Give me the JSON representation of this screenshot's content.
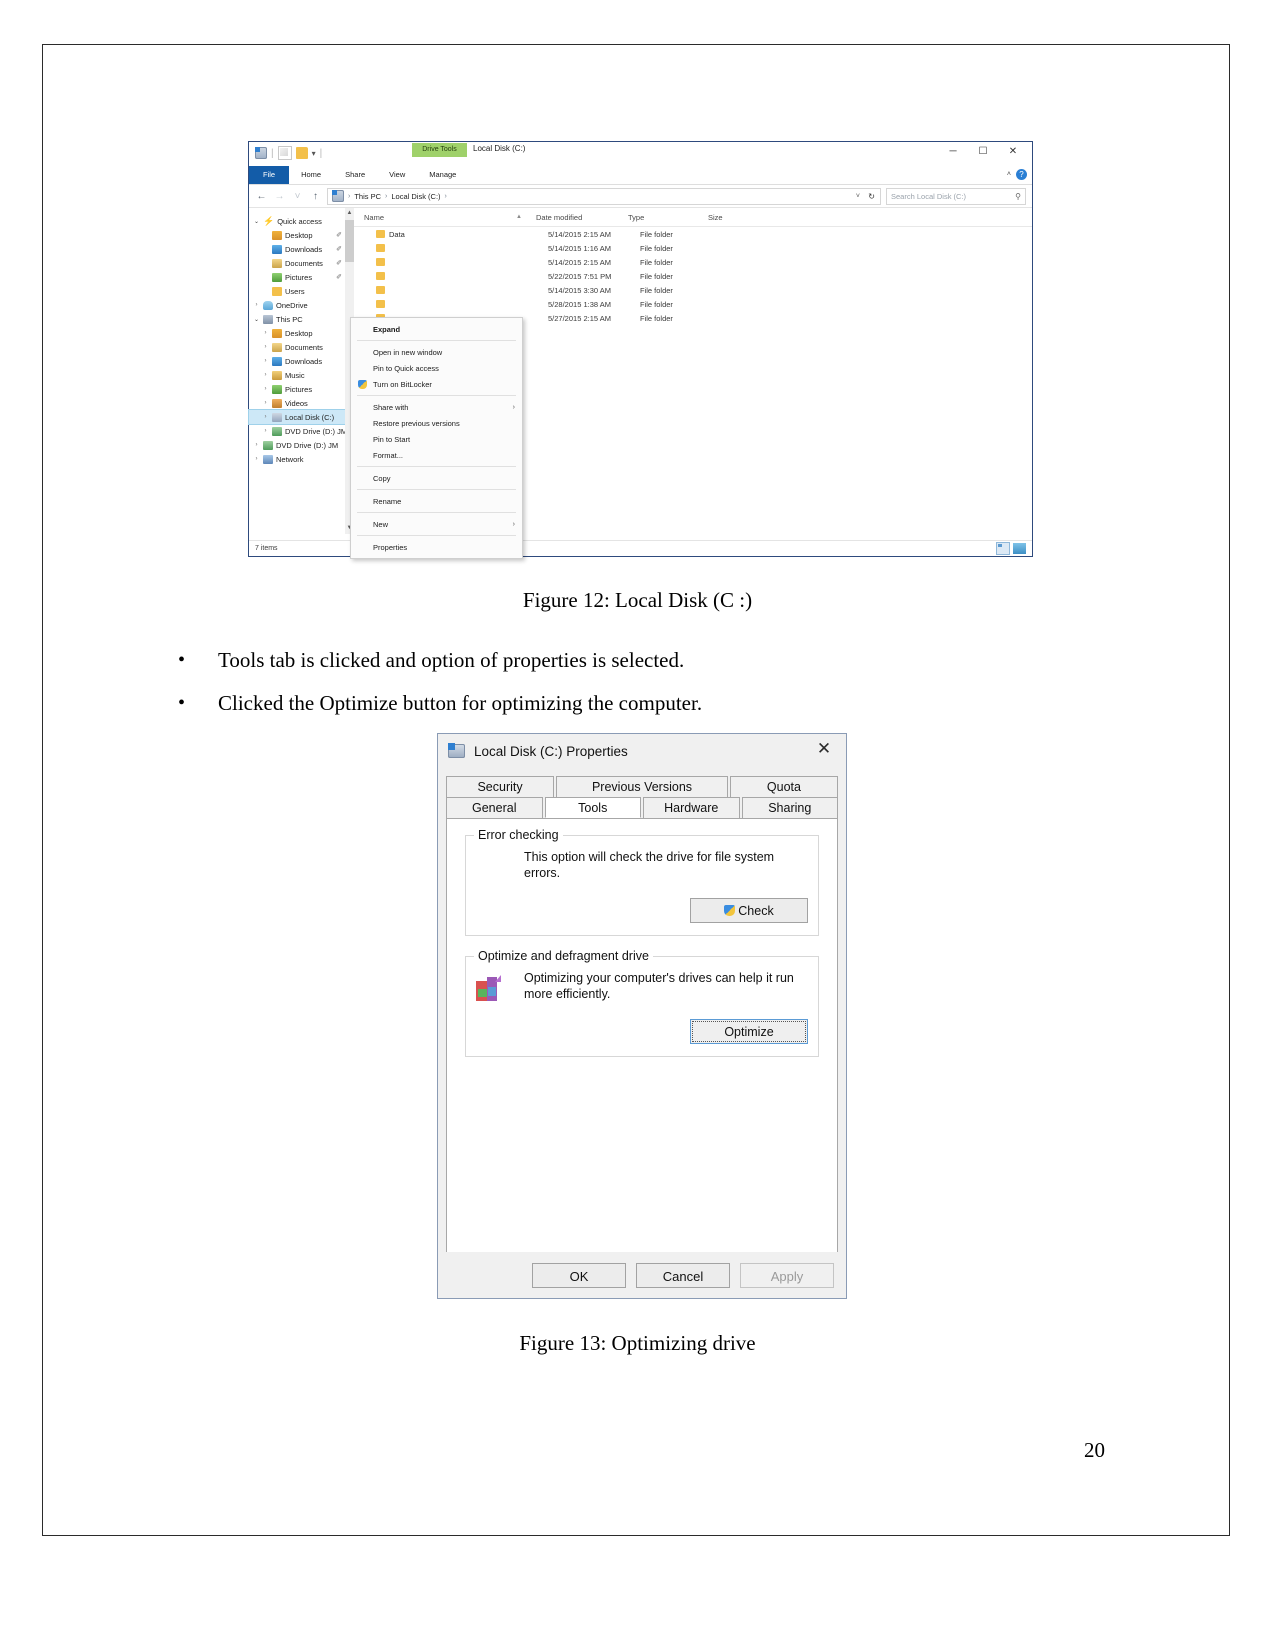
{
  "document": {
    "figure12_caption": "Figure 12: Local Disk (C :)",
    "figure13_caption": "Figure 13: Optimizing drive",
    "page_number": "20",
    "bullets": [
      {
        "marker": "•",
        "text": "Tools tab is clicked and option of properties is selected."
      },
      {
        "marker": "•",
        "text": "Clicked the Optimize button for optimizing the computer."
      }
    ]
  },
  "explorer": {
    "window_title": "Local Disk (C:)",
    "contextual_tab": "Drive Tools",
    "quick_access_caret": "▾",
    "ribbon_tabs": [
      "File",
      "Home",
      "Share",
      "View",
      "Manage"
    ],
    "ribbon_caret": "˄",
    "help_label": "?",
    "nav": {
      "back": "←",
      "forward": "→",
      "recent": "˅",
      "up": "↑"
    },
    "breadcrumb": [
      "This PC",
      "Local Disk (C:)"
    ],
    "breadcrumb_sep": "›",
    "breadcrumb_caret": "˅",
    "refresh_icon": "↻",
    "search_placeholder": "Search Local Disk (C:)",
    "search_icon": "⚲",
    "window_controls": {
      "minimize": "─",
      "maximize": "☐",
      "close": "✕"
    },
    "columns": [
      "Name",
      "Date modified",
      "Type",
      "Size"
    ],
    "rows": [
      {
        "name": "Data",
        "date": "5/14/2015 2:15 AM",
        "type": "File folder",
        "size": ""
      },
      {
        "name": "",
        "date": "5/14/2015 1:16 AM",
        "type": "File folder",
        "size": ""
      },
      {
        "name": "",
        "date": "5/14/2015 2:15 AM",
        "type": "File folder",
        "size": ""
      },
      {
        "name": "",
        "date": "5/22/2015 7:51 PM",
        "type": "File folder",
        "size": ""
      },
      {
        "name": "",
        "date": "5/14/2015 3:30 AM",
        "type": "File folder",
        "size": ""
      },
      {
        "name": "",
        "date": "5/28/2015 1:38 AM",
        "type": "File folder",
        "size": ""
      },
      {
        "name": "",
        "date": "5/27/2015 2:15 AM",
        "type": "File folder",
        "size": ""
      }
    ],
    "tree": [
      {
        "label": "Quick access",
        "arrow": "⌄",
        "icon": "star-icon",
        "indent": 0,
        "selected": false
      },
      {
        "label": "Desktop",
        "arrow": "",
        "icon": "desktop-icon",
        "indent": 1,
        "selected": false,
        "pinned": true
      },
      {
        "label": "Downloads",
        "arrow": "",
        "icon": "downloads-icon",
        "indent": 1,
        "selected": false,
        "pinned": true
      },
      {
        "label": "Documents",
        "arrow": "",
        "icon": "documents-icon",
        "indent": 1,
        "selected": false,
        "pinned": true
      },
      {
        "label": "Pictures",
        "arrow": "",
        "icon": "pictures-icon",
        "indent": 1,
        "selected": false,
        "pinned": true
      },
      {
        "label": "Users",
        "arrow": "",
        "icon": "folder-icon",
        "indent": 1,
        "selected": false
      },
      {
        "label": "OneDrive",
        "arrow": "›",
        "icon": "onedrive-icon",
        "indent": 0,
        "selected": false
      },
      {
        "label": "This PC",
        "arrow": "⌄",
        "icon": "thispc-icon",
        "indent": 0,
        "selected": false
      },
      {
        "label": "Desktop",
        "arrow": "›",
        "icon": "desktop-icon",
        "indent": 1,
        "selected": false
      },
      {
        "label": "Documents",
        "arrow": "›",
        "icon": "documents-icon",
        "indent": 1,
        "selected": false
      },
      {
        "label": "Downloads",
        "arrow": "›",
        "icon": "downloads-icon",
        "indent": 1,
        "selected": false
      },
      {
        "label": "Music",
        "arrow": "›",
        "icon": "music-icon",
        "indent": 1,
        "selected": false
      },
      {
        "label": "Pictures",
        "arrow": "›",
        "icon": "pictures-icon",
        "indent": 1,
        "selected": false
      },
      {
        "label": "Videos",
        "arrow": "›",
        "icon": "videos-icon",
        "indent": 1,
        "selected": false
      },
      {
        "label": "Local Disk (C:)",
        "arrow": "›",
        "icon": "disk-icon",
        "indent": 1,
        "selected": true
      },
      {
        "label": "DVD Drive (D:) JM",
        "arrow": "›",
        "icon": "dvd-icon",
        "indent": 1,
        "selected": false
      },
      {
        "label": "DVD Drive (D:) JM",
        "arrow": "›",
        "icon": "dvd-icon",
        "indent": 0,
        "selected": false
      },
      {
        "label": "Network",
        "arrow": "›",
        "icon": "network-icon",
        "indent": 0,
        "selected": false
      }
    ],
    "context_menu": [
      {
        "label": "Expand",
        "bold": true
      },
      {
        "sep": true
      },
      {
        "label": "Open in new window"
      },
      {
        "label": "Pin to Quick access"
      },
      {
        "label": "Turn on BitLocker",
        "shield": true
      },
      {
        "sep": true
      },
      {
        "label": "Share with",
        "submenu": "›"
      },
      {
        "label": "Restore previous versions"
      },
      {
        "label": "Pin to Start"
      },
      {
        "label": "Format..."
      },
      {
        "sep": true
      },
      {
        "label": "Copy"
      },
      {
        "sep": true
      },
      {
        "label": "Rename"
      },
      {
        "sep": true
      },
      {
        "label": "New",
        "submenu": "›"
      },
      {
        "sep": true
      },
      {
        "label": "Properties"
      }
    ],
    "status_text": "7 items"
  },
  "dialog": {
    "title": "Local Disk (C:) Properties",
    "close_label": "✕",
    "tabs_top": [
      "Security",
      "Previous Versions",
      "Quota"
    ],
    "tabs_bottom": [
      "General",
      "Tools",
      "Hardware",
      "Sharing"
    ],
    "active_tab": "Tools",
    "error_checking": {
      "legend": "Error checking",
      "description": "This option will check the drive for file system errors.",
      "button": "Check"
    },
    "optimize": {
      "legend": "Optimize and defragment drive",
      "description": "Optimizing your computer's drives can help it run more efficiently.",
      "button": "Optimize"
    },
    "footer": {
      "ok": "OK",
      "cancel": "Cancel",
      "apply": "Apply"
    }
  },
  "colors": {
    "accent_blue": "#135ca8",
    "contextual_tab_green": "#9fd16a",
    "selection_blue": "#cde8f7",
    "dialog_bg": "#f0f0f0"
  }
}
